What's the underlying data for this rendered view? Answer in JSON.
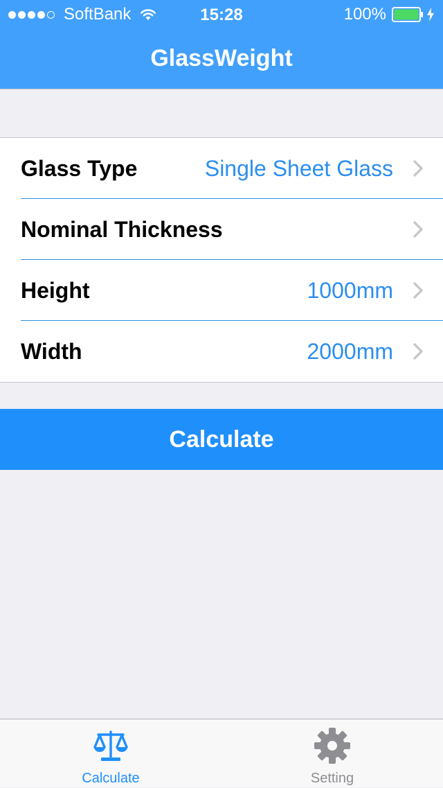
{
  "status_bar": {
    "carrier": "SoftBank",
    "time": "15:28",
    "battery": "100%"
  },
  "nav": {
    "title": "GlassWeight"
  },
  "rows": [
    {
      "label": "Glass Type",
      "value": "Single Sheet Glass"
    },
    {
      "label": "Nominal Thickness",
      "value": ""
    },
    {
      "label": "Height",
      "value": "1000mm"
    },
    {
      "label": "Width",
      "value": "2000mm"
    }
  ],
  "calculate_button": {
    "label": "Calculate"
  },
  "tabs": [
    {
      "label": "Calculate",
      "icon": "scale-icon",
      "selected": true
    },
    {
      "label": "Setting",
      "icon": "gear-icon",
      "selected": false
    }
  ],
  "colors": {
    "nav_bar": "#41a0fb",
    "accent": "#1f8ffb",
    "value_text": "#2c8ef0",
    "background": "#efeff4",
    "battery_fill": "#4cd964"
  }
}
